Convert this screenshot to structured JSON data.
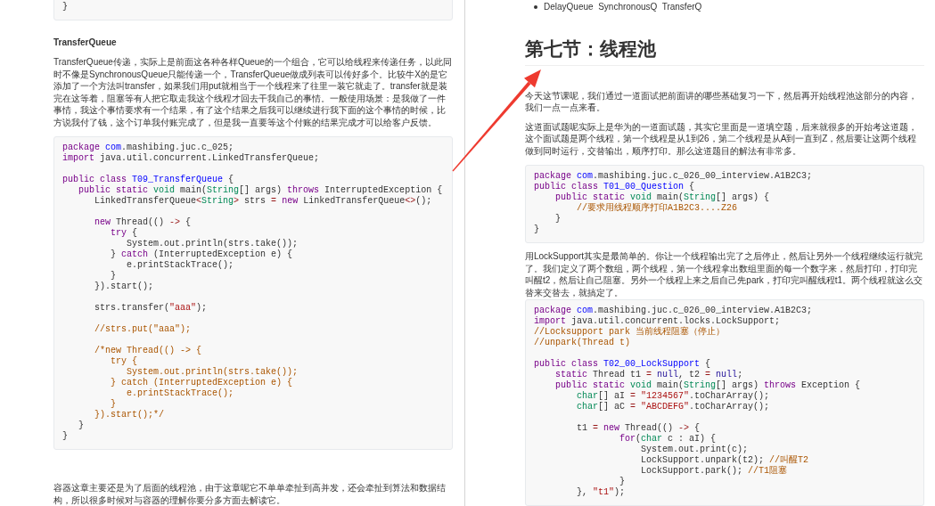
{
  "left_page": {
    "blocks": [
      {
        "kind": "code",
        "groups": [
          [
            [
              {
                "kind": "plain",
                "text": "}"
              }
            ]
          ]
        ]
      },
      {
        "kind": "subheading",
        "text": "TransferQueue"
      },
      {
        "kind": "paragraph",
        "text": "TransferQueue传递，实际上是前面这各种各样Queue的一个组合，它可以给线程来传递任务，以此同时不像是SynchronousQueue只能传递一个，TransferQueue做成列表可以传好多个。比较牛X的是它添加了一个方法叫transfer，如果我们用put就相当于一个线程来了往里一装它就走了。transfer就是装完在这等着，阻塞等有人把它取走我这个线程才回去干我自己的事情。一般使用场景：是我做了一件事情，我这个事情要求有一个结果，有了这个结果之后我可以继续进行我下面的这个事情的时候，比方说我付了钱，这个订单我付账完成了，但是我一直要等这个付账的结果完成才可以给客户反馈。"
      },
      {
        "kind": "code",
        "groups": [
          [
            [
              {
                "kind": "keyword",
                "text": "package "
              },
              {
                "kind": "definition",
                "text": "com"
              },
              {
                "kind": "plain",
                "text": ".mashibing.juc.c_025;"
              }
            ],
            [
              {
                "kind": "keyword",
                "text": "import"
              },
              {
                "kind": "plain",
                "text": " java.util.concurrent.LinkedTransferQueue;"
              }
            ]
          ],
          [
            [
              {
                "kind": "keyword",
                "text": "public class "
              },
              {
                "kind": "definition",
                "text": "T09_TransferQueue"
              },
              {
                "kind": "plain",
                "text": " {"
              }
            ],
            [
              {
                "kind": "keyword",
                "text": "   public static "
              },
              {
                "kind": "type",
                "text": "void"
              },
              {
                "kind": "plain",
                "text": " main("
              },
              {
                "kind": "type",
                "text": "String"
              },
              {
                "kind": "plain",
                "text": "[] args) "
              },
              {
                "kind": "keyword",
                "text": "throws"
              },
              {
                "kind": "plain",
                "text": " InterruptedException {"
              }
            ],
            [
              {
                "kind": "plain",
                "text": "      LinkedTransferQueue"
              },
              {
                "kind": "operator",
                "text": "<"
              },
              {
                "kind": "type",
                "text": "String"
              },
              {
                "kind": "operator",
                "text": ">"
              },
              {
                "kind": "plain",
                "text": " strs "
              },
              {
                "kind": "operator",
                "text": "="
              },
              {
                "kind": "keyword",
                "text": " new"
              },
              {
                "kind": "plain",
                "text": " LinkedTransferQueue"
              },
              {
                "kind": "operator",
                "text": "<>"
              },
              {
                "kind": "plain",
                "text": "();"
              }
            ]
          ],
          [
            [
              {
                "kind": "keyword",
                "text": "      new"
              },
              {
                "kind": "plain",
                "text": " Thread(() "
              },
              {
                "kind": "operator",
                "text": "->"
              },
              {
                "kind": "plain",
                "text": " {"
              }
            ],
            [
              {
                "kind": "keyword",
                "text": "         try"
              },
              {
                "kind": "plain",
                "text": " {"
              }
            ],
            [
              {
                "kind": "plain",
                "text": "            System.out.println(strs.take());"
              }
            ],
            [
              {
                "kind": "plain",
                "text": "         } "
              },
              {
                "kind": "keyword",
                "text": "catch"
              },
              {
                "kind": "plain",
                "text": " (InterruptedException e) {"
              }
            ],
            [
              {
                "kind": "plain",
                "text": "            e.printStackTrace();"
              }
            ],
            [
              {
                "kind": "plain",
                "text": "         }"
              }
            ],
            [
              {
                "kind": "plain",
                "text": "      }).start();"
              }
            ]
          ],
          [
            [
              {
                "kind": "plain",
                "text": "      strs.transfer("
              },
              {
                "kind": "string",
                "text": "\"aaa\""
              },
              {
                "kind": "plain",
                "text": ");"
              }
            ]
          ],
          [
            [
              {
                "kind": "comment",
                "text": "      //strs.put(\"aaa\");"
              }
            ]
          ],
          [
            [
              {
                "kind": "comment",
                "text": "      /*new Thread(() -> {"
              }
            ],
            [
              {
                "kind": "comment",
                "text": "         try {"
              }
            ],
            [
              {
                "kind": "comment",
                "text": "            System.out.println(strs.take());"
              }
            ],
            [
              {
                "kind": "comment",
                "text": "         } catch (InterruptedException e) {"
              }
            ],
            [
              {
                "kind": "comment",
                "text": "            e.printStackTrace();"
              }
            ],
            [
              {
                "kind": "comment",
                "text": "         }"
              }
            ],
            [
              {
                "kind": "comment",
                "text": "      }).start();*/"
              }
            ],
            [
              {
                "kind": "plain",
                "text": "   }"
              }
            ],
            [
              {
                "kind": "plain",
                "text": "}"
              }
            ]
          ]
        ]
      },
      {
        "kind": "paragraph",
        "text": "容器这章主要还是为了后面的线程池，由于这章呢它不单单牵扯到高并发，还会牵扯到算法和数据结构，所以很多时候对与容器的理解你要分多方面去解读它。"
      }
    ]
  },
  "right_page": {
    "blocks": [
      {
        "kind": "bullet_list",
        "items": [
          "DelayQueue  SynchronousQ  TransferQ"
        ]
      },
      {
        "kind": "heading",
        "text": "第七节：线程池"
      },
      {
        "kind": "paragraph",
        "text": "今天这节课呢，我们通过一道面试把前面讲的哪些基础复习一下，然后再开始线程池这部分的内容，我们一点一点来看。"
      },
      {
        "kind": "paragraph",
        "text": "这道面试题呢实际上是华为的一道面试题，其实它里面是一道填空题，后来就很多的开始考这道题，这个面试题是两个线程，第一个线程是从1到26，第二个线程是从A到一直到Z，然后要让这两个线程做到同时运行，交替输出，顺序打印。那么这道题目的解法有非常多。"
      },
      {
        "kind": "code",
        "groups": [
          [
            [
              {
                "kind": "keyword",
                "text": "package "
              },
              {
                "kind": "definition",
                "text": "com"
              },
              {
                "kind": "plain",
                "text": ".mashibing.juc.c_026_00_interview.A1B2C3;"
              }
            ],
            [
              {
                "kind": "keyword",
                "text": "public class "
              },
              {
                "kind": "definition",
                "text": "T01_00_Question"
              },
              {
                "kind": "plain",
                "text": " {"
              }
            ],
            [
              {
                "kind": "keyword",
                "text": "    public static "
              },
              {
                "kind": "type",
                "text": "void"
              },
              {
                "kind": "plain",
                "text": " main("
              },
              {
                "kind": "type",
                "text": "String"
              },
              {
                "kind": "plain",
                "text": "[] args) {"
              }
            ],
            [
              {
                "kind": "comment",
                "text": "        //要求用线程顺序打印A1B2C3....Z26"
              }
            ],
            [
              {
                "kind": "plain",
                "text": "    }"
              }
            ],
            [
              {
                "kind": "plain",
                "text": "}"
              }
            ]
          ]
        ]
      },
      {
        "kind": "paragraph",
        "text": "用LockSupport其实是最简单的。你让一个线程输出完了之后停止，然后让另外一个线程继续运行就完了。我们定义了两个数组，两个线程，第一个线程拿出数组里面的每一个数字来，然后打印，打印完叫醒t2，然后让自己阻塞。另外一个线程上来之后自己先park，打印完叫醒线程t1。两个线程就这么交替来交替去，就搞定了。"
      },
      {
        "kind": "code",
        "groups": [
          [
            [
              {
                "kind": "keyword",
                "text": "package "
              },
              {
                "kind": "definition",
                "text": "com"
              },
              {
                "kind": "plain",
                "text": ".mashibing.juc.c_026_00_interview.A1B2C3;"
              }
            ],
            [
              {
                "kind": "keyword",
                "text": "import"
              },
              {
                "kind": "plain",
                "text": " java.util.concurrent.locks.LockSupport;"
              }
            ],
            [
              {
                "kind": "comment",
                "text": "//Locksupport park 当前线程阻塞（停止）"
              }
            ],
            [
              {
                "kind": "comment",
                "text": "//unpark(Thread t)"
              }
            ]
          ],
          [
            [
              {
                "kind": "keyword",
                "text": "public class "
              },
              {
                "kind": "definition",
                "text": "T02_00_LockSupport"
              },
              {
                "kind": "plain",
                "text": " {"
              }
            ],
            [
              {
                "kind": "keyword",
                "text": "    static"
              },
              {
                "kind": "plain",
                "text": " Thread t1 "
              },
              {
                "kind": "operator",
                "text": "="
              },
              {
                "kind": "atom",
                "text": " null"
              },
              {
                "kind": "plain",
                "text": ", t2 "
              },
              {
                "kind": "operator",
                "text": "="
              },
              {
                "kind": "atom",
                "text": " null"
              },
              {
                "kind": "plain",
                "text": ";"
              }
            ],
            [
              {
                "kind": "keyword",
                "text": "    public static "
              },
              {
                "kind": "type",
                "text": "void"
              },
              {
                "kind": "plain",
                "text": " main("
              },
              {
                "kind": "type",
                "text": "String"
              },
              {
                "kind": "plain",
                "text": "[] args) "
              },
              {
                "kind": "keyword",
                "text": "throws"
              },
              {
                "kind": "plain",
                "text": " Exception {"
              }
            ],
            [
              {
                "kind": "type",
                "text": "        char"
              },
              {
                "kind": "plain",
                "text": "[] aI "
              },
              {
                "kind": "operator",
                "text": "="
              },
              {
                "kind": "string",
                "text": " \"1234567\""
              },
              {
                "kind": "plain",
                "text": ".toCharArray();"
              }
            ],
            [
              {
                "kind": "type",
                "text": "        char"
              },
              {
                "kind": "plain",
                "text": "[] aC "
              },
              {
                "kind": "operator",
                "text": "="
              },
              {
                "kind": "string",
                "text": " \"ABCDEFG\""
              },
              {
                "kind": "plain",
                "text": ".toCharArray();"
              }
            ]
          ],
          [
            [
              {
                "kind": "plain",
                "text": "        t1 "
              },
              {
                "kind": "operator",
                "text": "="
              },
              {
                "kind": "keyword",
                "text": " new"
              },
              {
                "kind": "plain",
                "text": " Thread(() "
              },
              {
                "kind": "operator",
                "text": "->"
              },
              {
                "kind": "plain",
                "text": " {"
              }
            ],
            [
              {
                "kind": "keyword",
                "text": "                for"
              },
              {
                "kind": "plain",
                "text": "("
              },
              {
                "kind": "type",
                "text": "char"
              },
              {
                "kind": "plain",
                "text": " c : aI) {"
              }
            ],
            [
              {
                "kind": "plain",
                "text": "                    System.out.print(c);"
              }
            ],
            [
              {
                "kind": "plain",
                "text": "                    LockSupport.unpark(t2); "
              },
              {
                "kind": "comment",
                "text": "//叫醒T2"
              }
            ],
            [
              {
                "kind": "plain",
                "text": "                    LockSupport.park(); "
              },
              {
                "kind": "comment",
                "text": "//T1阻塞"
              }
            ],
            [
              {
                "kind": "plain",
                "text": "                }"
              }
            ],
            [
              {
                "kind": "plain",
                "text": "        }, "
              },
              {
                "kind": "string",
                "text": "\"t1\""
              },
              {
                "kind": "plain",
                "text": ");"
              }
            ]
          ]
        ]
      }
    ]
  }
}
